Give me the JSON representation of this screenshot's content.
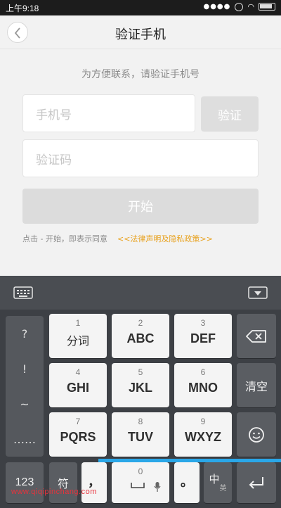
{
  "status_bar": {
    "time": "上午9:18"
  },
  "header": {
    "title": "验证手机"
  },
  "main": {
    "subtitle": "为方便联系，请验证手机号",
    "phone_placeholder": "手机号",
    "verify_label": "验证",
    "code_placeholder": "验证码",
    "start_label": "开始",
    "agree_text": "点击 - 开始，即表示同意",
    "policy_link": "<<法律声明及隐私政策>>"
  },
  "keyboard": {
    "side_keys": [
      "?",
      "!",
      "~",
      "……"
    ],
    "keys": [
      {
        "num": "1",
        "label": "分词"
      },
      {
        "num": "2",
        "label": "ABC"
      },
      {
        "num": "3",
        "label": "DEF"
      },
      {
        "num": "4",
        "label": "GHI"
      },
      {
        "num": "5",
        "label": "JKL"
      },
      {
        "num": "6",
        "label": "MNO"
      },
      {
        "num": "7",
        "label": "PQRS"
      },
      {
        "num": "8",
        "label": "TUV"
      },
      {
        "num": "9",
        "label": "WXYZ"
      }
    ],
    "clear_label": "清空",
    "num_label": "123",
    "symbol_label": "符",
    "comma_label": "，",
    "space_num": "0",
    "period_label": "。",
    "lang_main": "中",
    "lang_sub": "英"
  },
  "watermark": "www.qiqipinchang.com",
  "colors": {
    "accent": "#e8a21f",
    "keyboard_bg": "#3d4045",
    "highlight_line": "#2aa7e8"
  }
}
